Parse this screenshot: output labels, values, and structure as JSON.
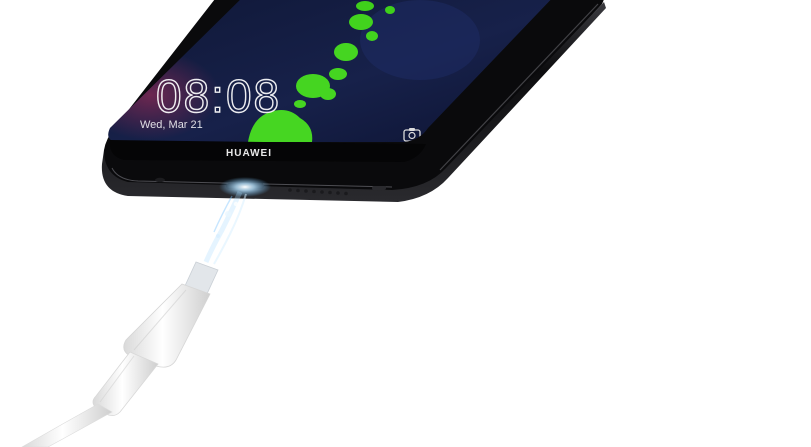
{
  "lock_screen": {
    "time": "08:08",
    "date": "Wed, Mar 21",
    "camera_icon": "camera-icon"
  },
  "phone": {
    "brand": "HUAWEI",
    "body_color": "#0b0b0d",
    "screen_color": "#131a3a"
  },
  "wallpaper": {
    "accent_color": "#44d21e"
  },
  "cable": {
    "color": "#f4f4f4",
    "glow_color": "#9fd6ff"
  }
}
